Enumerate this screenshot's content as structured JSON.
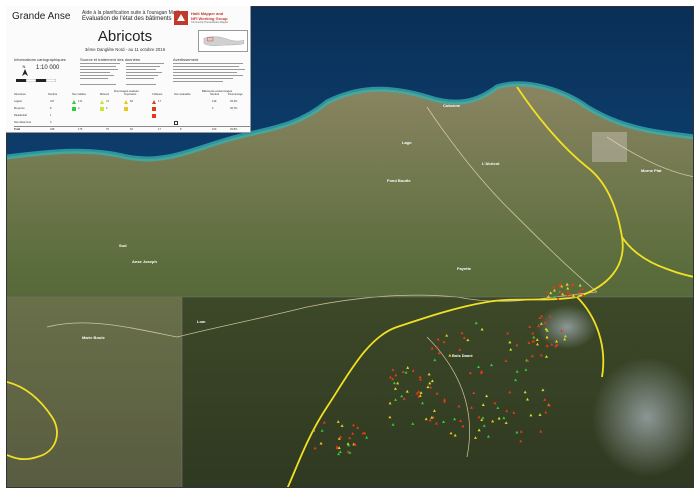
{
  "header": {
    "region": "Grande Anse",
    "aid_line1": "Aide à la planification suite à l'ouragan Matthew",
    "aid_line2": "Evaluation de l'état des bâtiments",
    "title": "Abricots",
    "subtitle": "3ème Dangléte Nord - au 11 octobre 2016"
  },
  "logo": {
    "name": "Haiti Mapper and",
    "name2": "NFI Working Group",
    "tag": "Community Humanitarian Mapper"
  },
  "sections": {
    "cartographic": "Informations cartographiques",
    "source": "Source et traitement des données",
    "notice": "Avertissement",
    "damage_header": "Dommages évalués",
    "buildings_header": "Bâtiments endommagés"
  },
  "scale": {
    "ratio": "1:10 000",
    "north": "N"
  },
  "legend": {
    "columns": [
      "Structures",
      "Nombre",
      "Non visibles",
      "Mineurs",
      "Importants",
      "Critiques",
      "Non évaluable",
      "Nombre",
      "Pourcentage"
    ],
    "rows": [
      {
        "label": "Légère",
        "n": "317",
        "c1": "171",
        "c2": "74",
        "c3": "52",
        "c4": "17",
        "c5": "",
        "n2": "149",
        "pct": "45,4%"
      },
      {
        "label": "Moyenne",
        "n": "8",
        "c1": "4",
        "c2": "2",
        "c3": "",
        "c4": "",
        "c5": "",
        "n2": "2",
        "pct": "36,7%"
      },
      {
        "label": "Résidentiel",
        "n": "1",
        "c1": "",
        "c2": "",
        "c3": "",
        "c4": "",
        "c5": "",
        "n2": "",
        "pct": ""
      },
      {
        "label": "Non déterminé",
        "n": "3",
        "c1": "",
        "c2": "",
        "c3": "",
        "c4": "",
        "c5": "",
        "n2": "",
        "pct": ""
      }
    ],
    "total": {
      "label": "Total",
      "n": "328",
      "c1": "175",
      "c2": "76",
      "c3": "52",
      "c4": "17",
      "c5": "8",
      "n2": "160",
      "pct": "45,8%"
    },
    "colors": {
      "non_visible": "#2ecc40",
      "minor": "#c8e62a",
      "important": "#f0c419",
      "critical": "#e43a1c",
      "unassessed": "#ffffff"
    }
  },
  "places": [
    {
      "name": "Cokonne"
    },
    {
      "name": "Lago"
    },
    {
      "name": "L'Abricot"
    },
    {
      "name": "Fond Boutte"
    },
    {
      "name": "Morne Plat"
    },
    {
      "name": "Anse Joseph"
    },
    {
      "name": "Fayette"
    },
    {
      "name": "Bois Damé"
    },
    {
      "name": "Marie Boule"
    },
    {
      "name": "Lom"
    },
    {
      "name": "Sud"
    }
  ],
  "colors": {
    "sea": "#0e4f82",
    "sea_shallow": "#2fa3a8",
    "land": "#6b7648",
    "boundary": "#f2e024",
    "roads": "#e8d9b0"
  }
}
